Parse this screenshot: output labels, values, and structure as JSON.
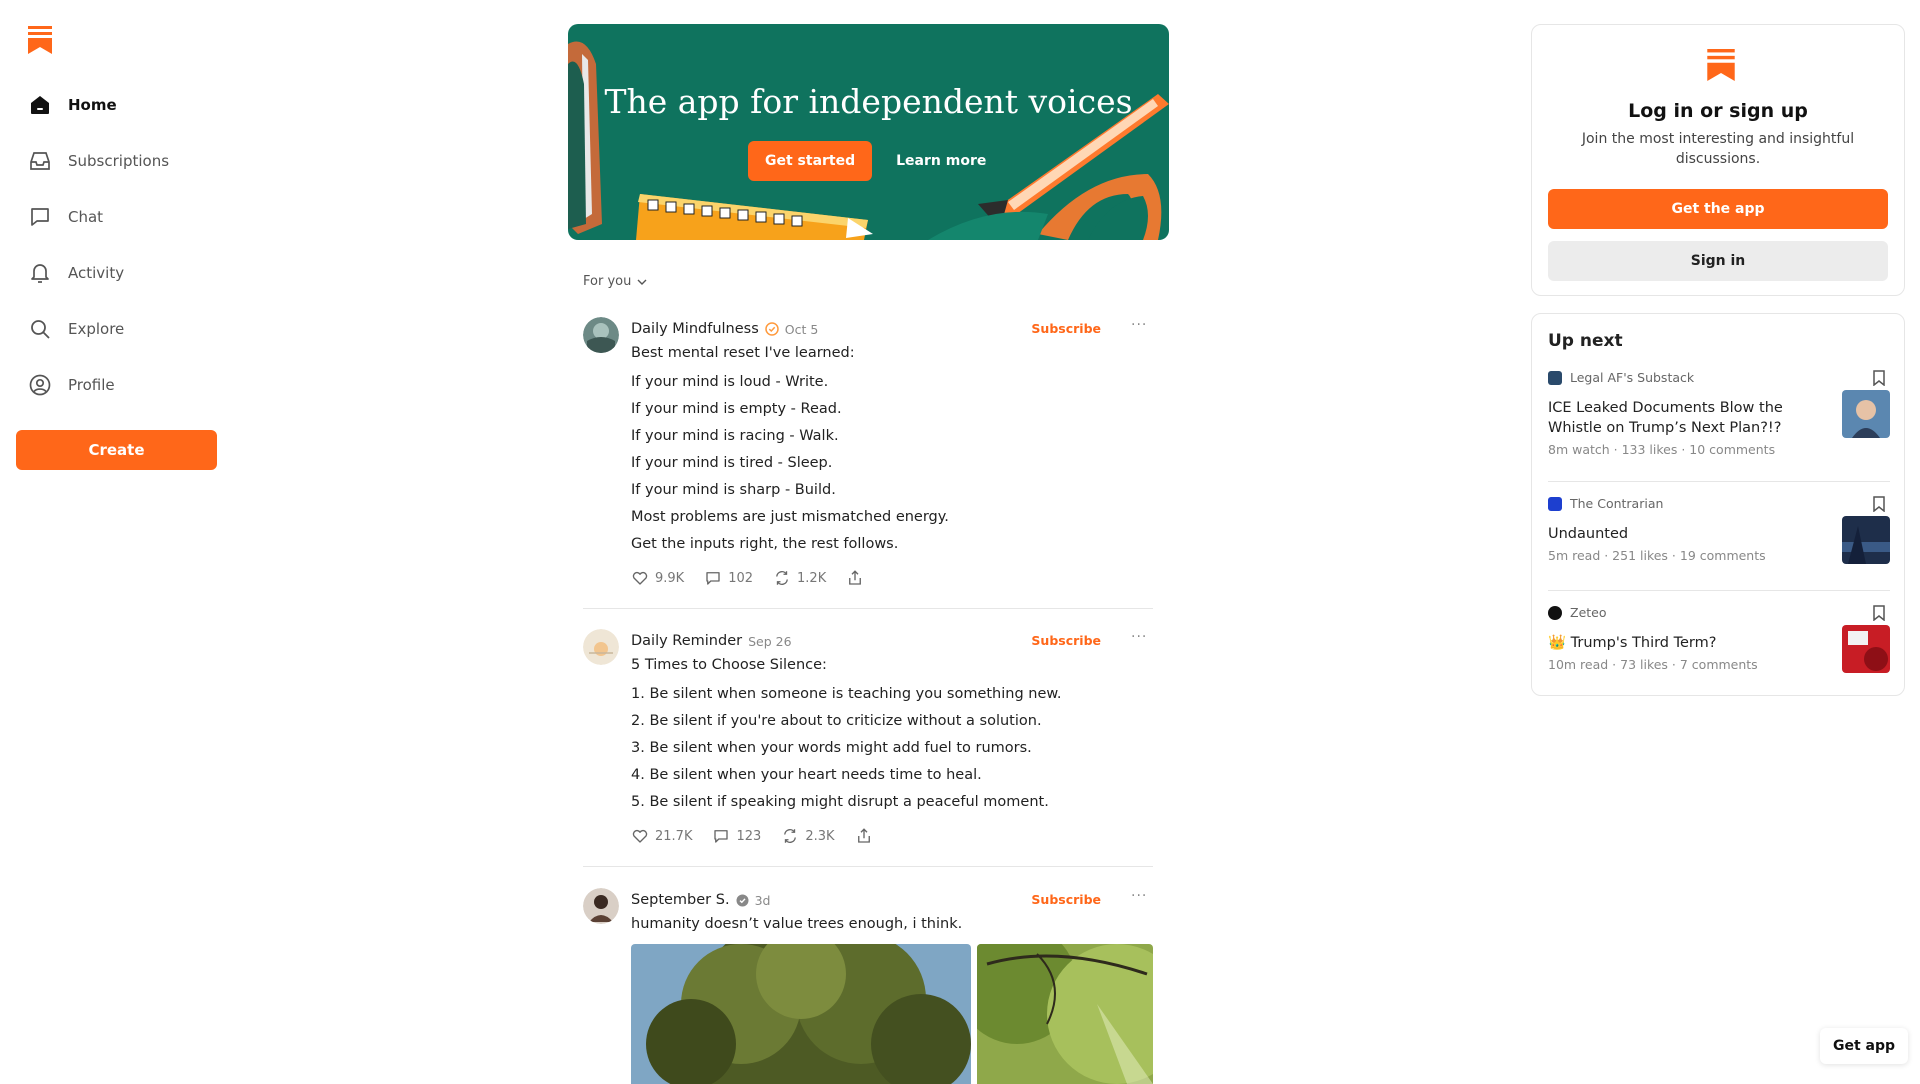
{
  "nav": {
    "items": [
      {
        "label": "Home",
        "icon": "home-icon"
      },
      {
        "label": "Subscriptions",
        "icon": "inbox-icon"
      },
      {
        "label": "Chat",
        "icon": "chat-bubble-icon"
      },
      {
        "label": "Activity",
        "icon": "bell-icon"
      },
      {
        "label": "Explore",
        "icon": "search-icon"
      },
      {
        "label": "Profile",
        "icon": "user-circle-icon"
      }
    ],
    "create_label": "Create"
  },
  "banner": {
    "title": "The app for independent voices",
    "get_started_label": "Get started",
    "learn_more_label": "Learn more"
  },
  "feed": {
    "filter_label": "For you",
    "subscribe_label": "Subscribe",
    "posts": [
      {
        "author": "Daily Mindfulness",
        "verified": true,
        "date": "Oct 5",
        "lines": [
          "Best mental reset I've learned:",
          "If your mind is loud - Write.",
          "If your mind is empty - Read.",
          "If your mind is racing - Walk.",
          "If your mind is tired - Sleep.",
          "If your mind is sharp - Build.",
          "Most problems are just mismatched energy.",
          "Get the inputs right, the rest follows."
        ],
        "likes": "9.9K",
        "comments": "102",
        "restacks": "1.2K"
      },
      {
        "author": "Daily Reminder",
        "date": "Sep 26",
        "lines": [
          "5 Times to Choose Silence:",
          "1. Be silent when someone is teaching you something new.",
          "2. Be silent if you're about to criticize without a solution.",
          "3. Be silent when your words might add fuel to rumors.",
          "4. Be silent when your heart needs time to heal.",
          "5. Be silent if speaking might disrupt a peaceful moment."
        ],
        "likes": "21.7K",
        "comments": "123",
        "restacks": "2.3K"
      },
      {
        "author": "September S.",
        "date": "3d",
        "lines": [
          "humanity doesn’t value trees enough, i think."
        ]
      }
    ]
  },
  "login": {
    "title": "Log in or sign up",
    "subtitle": "Join the most interesting and insightful discussions.",
    "get_app_label": "Get the app",
    "sign_in_label": "Sign in"
  },
  "up_next": {
    "title": "Up next",
    "items": [
      {
        "publication": "Legal AF's Substack",
        "title": "ICE Leaked Documents Blow the Whistle on Trump’s Next Plan?!?",
        "meta": "8m watch · 133 likes · 10 comments"
      },
      {
        "publication": "The Contrarian",
        "title": "Undaunted",
        "meta": "5m read · 251 likes · 19 comments"
      },
      {
        "publication": "Zeteo",
        "title": "👑 Trump's Third Term?",
        "meta": "10m read · 73 likes · 7 comments"
      }
    ]
  },
  "floating": {
    "get_app_label": "Get app"
  },
  "colors": {
    "accent": "#ff6719",
    "banner_bg": "#0f735e"
  }
}
